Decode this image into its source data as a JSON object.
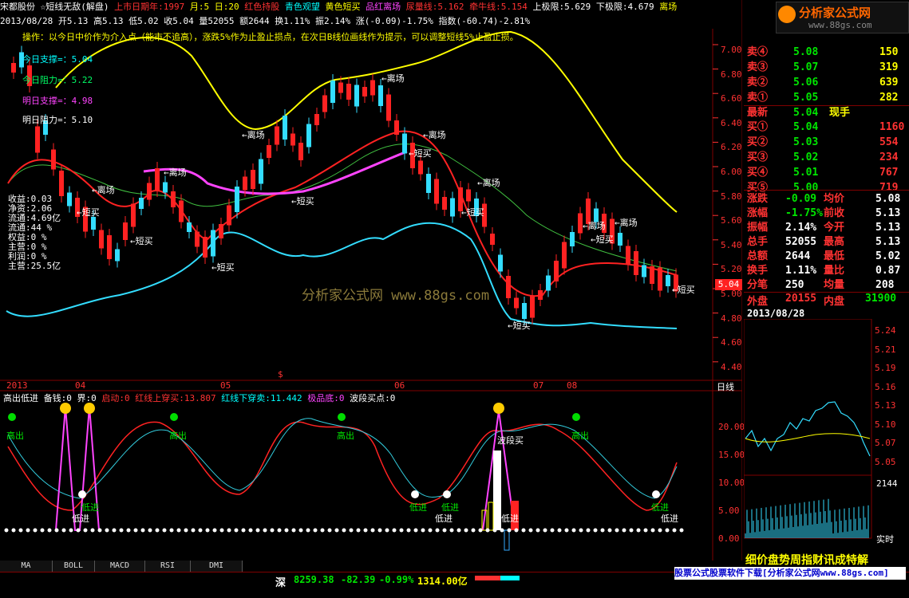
{
  "header": {
    "stock_name": "宋都股份",
    "indicator_title": "☆短线无敌(解盘)",
    "listing": "上市日期年:1997",
    "month": "月:5",
    "day": "日:20",
    "red_hold": "红色持股",
    "cyan_watch": "青色观望",
    "yellow_short": "黄色短买",
    "magenta_exit": "品红离场",
    "bear_line": "尿量线:5.162",
    "bull_line": "牵牛线:5.154",
    "upper_limit": "上极限:5.629",
    "lower_limit": "下极限:4.679",
    "exit_label": "离场"
  },
  "info": {
    "date": "2013/08/28",
    "open": "开5.13",
    "high": "高5.13",
    "low": "低5.02",
    "close": "收5.04",
    "volume": "量52055",
    "amount": "额2644",
    "turnover": "换1.11%",
    "amplitude": "振2.14%",
    "change": "涨(-0.09)-1.75%",
    "index": "指数(-60.74)-2.81%"
  },
  "operation_text": "操作：以今日中价作为介入点（能市不追高），涨跌5%作为止盈止损点，在次日B线位画线作为提示，可以调整短线5%止盈止损。",
  "levels": {
    "today_support": "今日支撑=：5.04",
    "today_resist": "今日阻力=：5.22",
    "tomorrow_support": "明日支撑=：4.98",
    "tomorrow_resist": "明日阻力=：5.10"
  },
  "fundamentals": {
    "income": "收益:0.03",
    "net_asset": "净资:2.06",
    "float_shares": "流通:4.69亿",
    "float_pct": "流通:44 %",
    "equity": "权益:0 %",
    "main_ops": "主营:0 %",
    "profit": "利润:0 %",
    "main_revenue": "主营:25.5亿"
  },
  "chart_labels": {
    "exit": "离场",
    "short_buy": "短买",
    "high_out": "高出",
    "low_in": "低进",
    "wave_buy": "波段买",
    "last_price_tag": "5.04",
    "watermark": "分析家公式网  www.88gs.com",
    "dollar": "$"
  },
  "price_axis": [
    "7.00",
    "6.80",
    "6.60",
    "6.40",
    "6.20",
    "6.00",
    "5.80",
    "5.60",
    "5.40",
    "5.20",
    "5.00",
    "4.80",
    "4.60",
    "4.40"
  ],
  "time_axis": [
    "2013",
    "04",
    "05",
    "06",
    "07",
    "08"
  ],
  "period": "日线",
  "sub_header": {
    "title": "高出低进",
    "reserve": "备钱:0",
    "boundary": "界:0",
    "start": "启动:0",
    "red_up": "红线上穿买:13.807",
    "red_down": "红线下穿卖:11.442",
    "bottom": "极品底:0",
    "wave_point": "波段买点:0"
  },
  "sub_axis": [
    "20.00",
    "15.00",
    "10.00",
    "5.00",
    "0.00"
  ],
  "tabs": [
    "MA",
    "BOLL",
    "MACD",
    "RSI",
    "DMI"
  ],
  "logo": {
    "title": "分析家公式网",
    "url": "www.88gs.com"
  },
  "quote": {
    "sells": [
      {
        "label": "卖④",
        "price": "5.08",
        "vol": "150"
      },
      {
        "label": "卖③",
        "price": "5.07",
        "vol": "319"
      },
      {
        "label": "卖②",
        "price": "5.06",
        "vol": "639"
      },
      {
        "label": "卖①",
        "price": "5.05",
        "vol": "282"
      }
    ],
    "latest_label": "最新",
    "latest_price": "5.04",
    "latest_note": "现手",
    "buys": [
      {
        "label": "买①",
        "price": "5.04",
        "vol": "1160"
      },
      {
        "label": "买②",
        "price": "5.03",
        "vol": "554"
      },
      {
        "label": "买③",
        "price": "5.02",
        "vol": "234"
      },
      {
        "label": "买④",
        "price": "5.01",
        "vol": "767"
      },
      {
        "label": "买⑤",
        "price": "5.00",
        "vol": "719"
      }
    ],
    "stats": [
      {
        "k1": "涨跌",
        "v1": "-0.09",
        "k2": "均价",
        "v2": "5.08"
      },
      {
        "k1": "涨幅",
        "v1": "-1.75%",
        "k2": "前收",
        "v2": "5.13"
      },
      {
        "k1": "振幅",
        "v1": "2.14%",
        "k2": "今开",
        "v2": "5.13"
      },
      {
        "k1": "总手",
        "v1": "52055",
        "k2": "最高",
        "v2": "5.13"
      },
      {
        "k1": "总额",
        "v1": "2644",
        "k2": "最低",
        "v2": "5.02"
      },
      {
        "k1": "换手",
        "v1": "1.11%",
        "k2": "量比",
        "v2": "0.87"
      },
      {
        "k1": "分笔",
        "v1": "250",
        "k2": "均量",
        "v2": "208"
      }
    ],
    "outer_label": "外盘",
    "outer": "20155",
    "inner_label": "内盘",
    "inner": "31900",
    "mini_date": "2013/08/28",
    "mini_axis": [
      "5.24",
      "5.21",
      "5.19",
      "5.16",
      "5.13",
      "5.10",
      "5.07",
      "5.05"
    ],
    "mini_vol": "2144",
    "realtime": "实时",
    "bottom_menu": "细价盘势周指财讯成特解"
  },
  "status": {
    "market": "深",
    "index": "8259.38",
    "change": "-82.39",
    "pct": "-0.99%",
    "amount": "1314.00亿",
    "ad": "股票公式股票软件下载[分析家公式网www.88gs.com]"
  }
}
